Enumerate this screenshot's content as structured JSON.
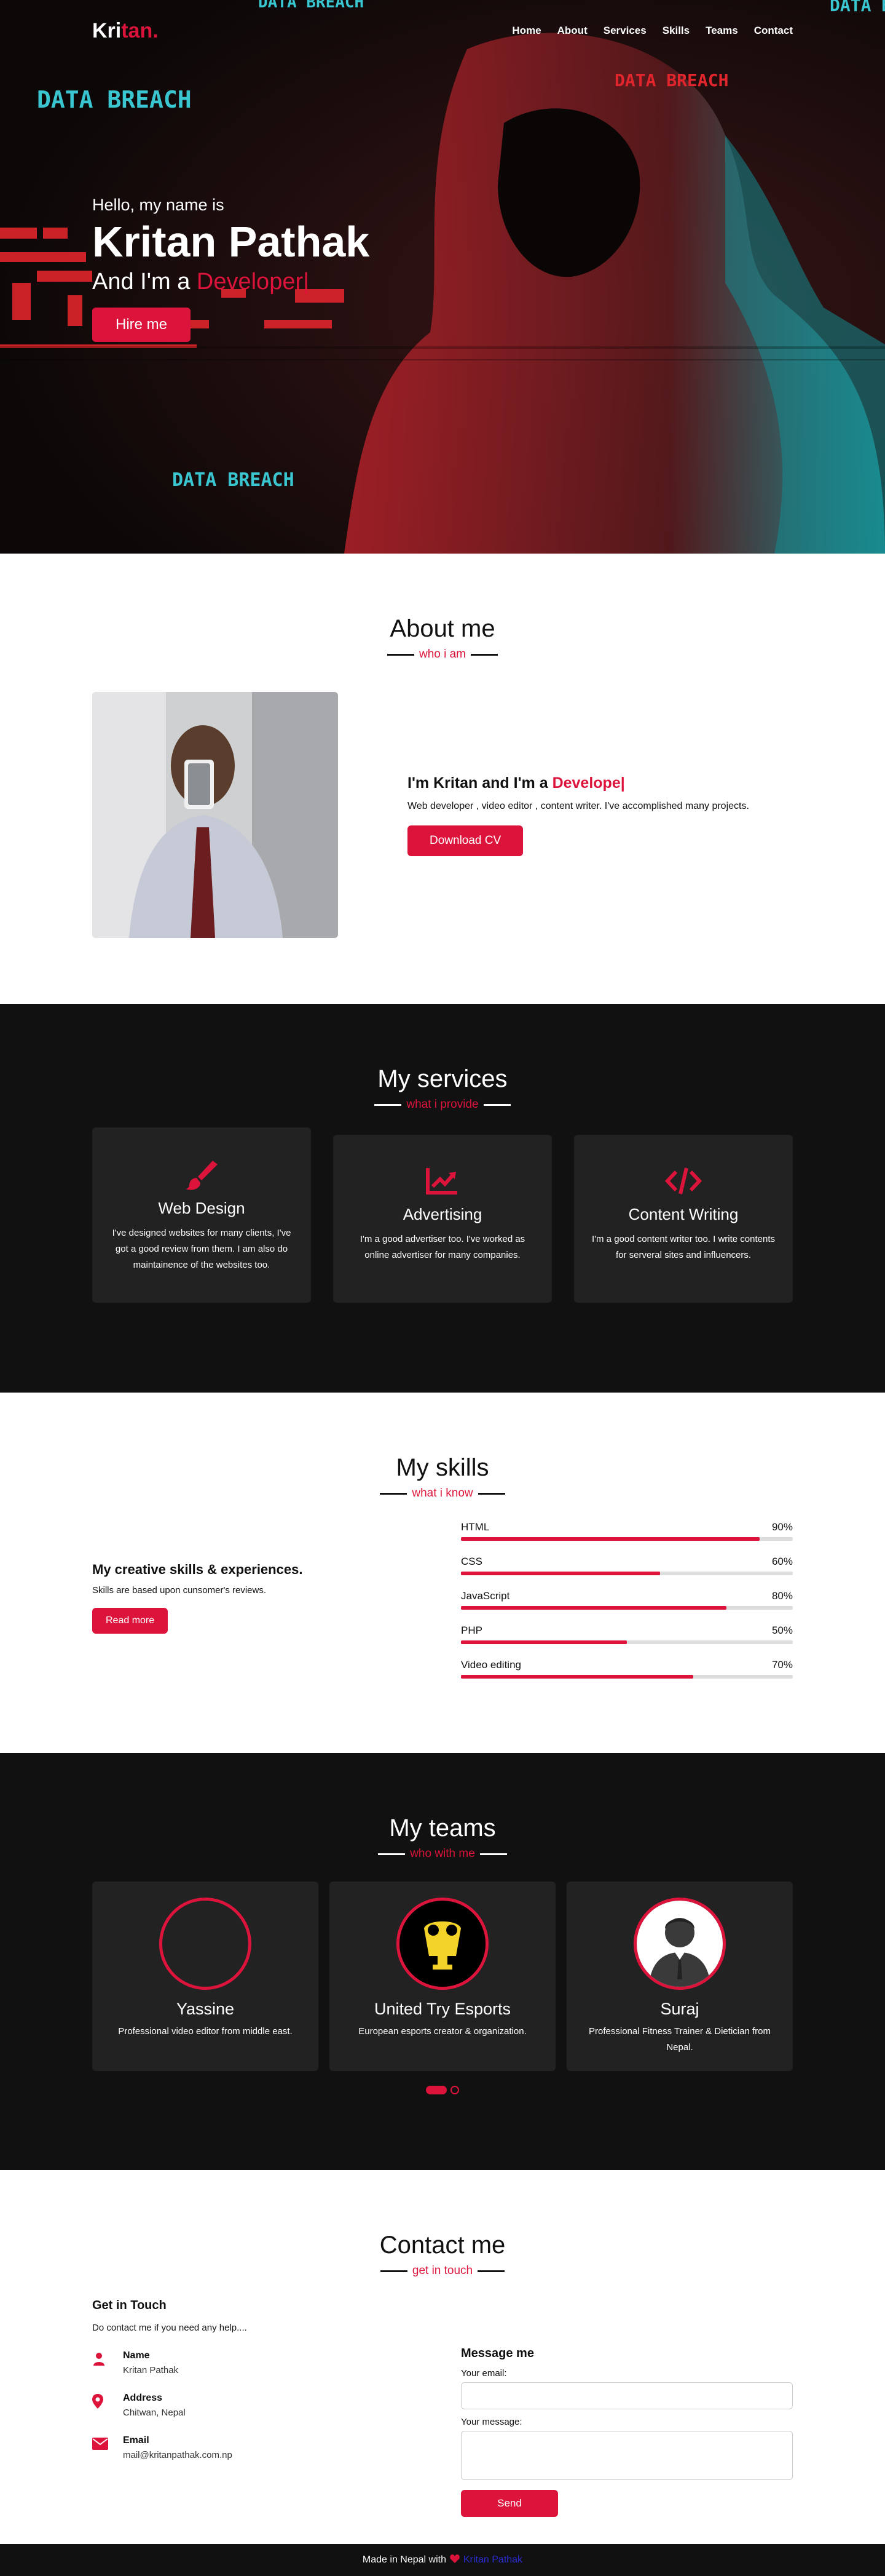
{
  "brand": {
    "logo_prefix": "Kri",
    "logo_suffix": "tan."
  },
  "nav": {
    "items": [
      "Home",
      "About",
      "Services",
      "Skills",
      "Teams",
      "Contact"
    ]
  },
  "hero": {
    "greeting": "Hello, my name is",
    "name": "Kritan Pathak",
    "role_prefix": "And I'm a",
    "role_typed": "Developer|",
    "button": "Hire me",
    "overlay_texts": [
      "DATA BREACH",
      "DATA BREACH",
      "DATA BREACH",
      "DATA BREACH",
      "DATA BREACH"
    ]
  },
  "about": {
    "title": "About me",
    "subtitle": "who i am",
    "heading_prefix": "I'm Kritan and I'm a",
    "heading_typed": "Develope|",
    "text": "Web developer , video editor , content writer. I've accomplished many projects.",
    "button": "Download CV"
  },
  "services": {
    "title": "My services",
    "subtitle": "what i provide",
    "cards": [
      {
        "icon": "paint-brush-icon",
        "title": "Web Design",
        "text": "I've designed websites for many clients, I've got a good review from them. I am also do maintainence of the websites too."
      },
      {
        "icon": "chart-line-icon",
        "title": "Advertising",
        "text": "I'm a good advertiser too. I've worked as online advertiser for many companies."
      },
      {
        "icon": "code-icon",
        "title": "Content Writing",
        "text": "I'm a good content writer too. I write contents for serveral sites and influencers."
      }
    ]
  },
  "skills": {
    "title": "My skills",
    "subtitle": "what i know",
    "heading": "My creative skills & experiences.",
    "text": "Skills are based upon cunsomer's reviews.",
    "button": "Read more",
    "bars": [
      {
        "name": "HTML",
        "percent_label": "90%",
        "value": 90
      },
      {
        "name": "CSS",
        "percent_label": "60%",
        "value": 60
      },
      {
        "name": "JavaScript",
        "percent_label": "80%",
        "value": 80
      },
      {
        "name": "PHP",
        "percent_label": "50%",
        "value": 50
      },
      {
        "name": "Video editing",
        "percent_label": "70%",
        "value": 70
      }
    ]
  },
  "teams": {
    "title": "My teams",
    "subtitle": "who with me",
    "members": [
      {
        "name": "Yassine",
        "text": "Professional video editor from middle east."
      },
      {
        "name": "United Try Esports",
        "text": "European esports creator & organization."
      },
      {
        "name": "Suraj",
        "text": "Professional Fitness Trainer & Dietician from Nepal."
      }
    ]
  },
  "contact": {
    "title": "Contact me",
    "subtitle": "get in touch",
    "left_heading": "Get in Touch",
    "left_text": "Do contact me if you need any help....",
    "rows": [
      {
        "label": "Name",
        "value": "Kritan Pathak"
      },
      {
        "label": "Address",
        "value": "Chitwan, Nepal"
      },
      {
        "label": "Email",
        "value": "mail@kritanpathak.com.np"
      }
    ],
    "form_heading": "Message me",
    "email_label": "Your email:",
    "message_label": "Your message:",
    "send": "Send"
  },
  "footer": {
    "text": "Made in Nepal with",
    "link": "Kritan Pathak"
  },
  "colors": {
    "accent": "#dc143c",
    "dark": "#111111",
    "card": "#222222"
  }
}
